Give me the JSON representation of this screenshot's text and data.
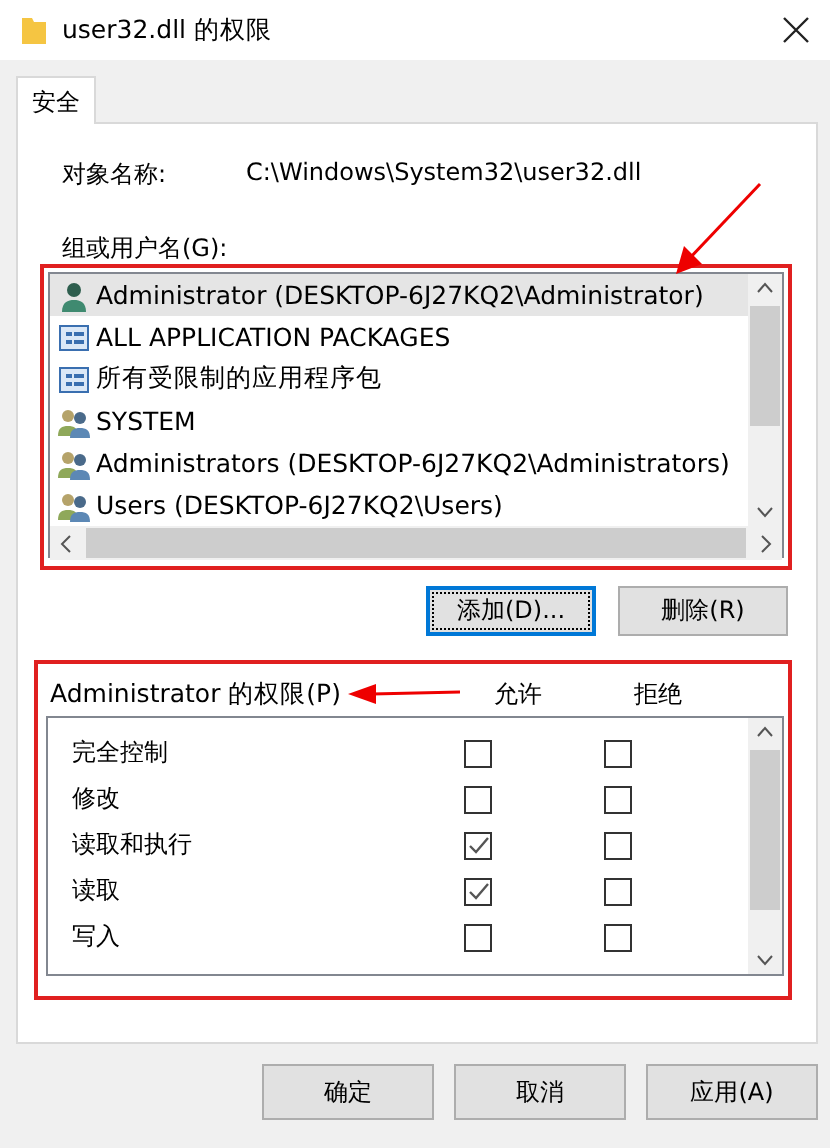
{
  "window": {
    "title": "user32.dll 的权限"
  },
  "tabs": [
    {
      "label": "安全",
      "selected": true
    }
  ],
  "object_name": {
    "label": "对象名称:",
    "value": "C:\\Windows\\System32\\user32.dll"
  },
  "groups": {
    "label": "组或用户名(G):",
    "items": [
      {
        "name": "Administrator (DESKTOP-6J27KQ2\\Administrator)",
        "kind": "user",
        "selected": true
      },
      {
        "name": "ALL APPLICATION PACKAGES",
        "kind": "package",
        "selected": false
      },
      {
        "name": "所有受限制的应用程序包",
        "kind": "package",
        "selected": false
      },
      {
        "name": "SYSTEM",
        "kind": "group",
        "selected": false
      },
      {
        "name": "Administrators (DESKTOP-6J27KQ2\\Administrators)",
        "kind": "group",
        "selected": false
      },
      {
        "name": "Users (DESKTOP-6J27KQ2\\Users)",
        "kind": "group",
        "selected": false
      }
    ],
    "buttons": [
      "添加(D)...",
      "删除(R)"
    ]
  },
  "permissions": {
    "label": "Administrator 的权限(P)",
    "allow_header": "允许",
    "deny_header": "拒绝",
    "rows": [
      {
        "name": "完全控制",
        "allow": false,
        "deny": false
      },
      {
        "name": "修改",
        "allow": false,
        "deny": false
      },
      {
        "name": "读取和执行",
        "allow": true,
        "deny": false
      },
      {
        "name": "读取",
        "allow": true,
        "deny": false
      },
      {
        "name": "写入",
        "allow": false,
        "deny": false
      }
    ]
  },
  "buttons": [
    "确定",
    "取消",
    "应用(A)"
  ]
}
